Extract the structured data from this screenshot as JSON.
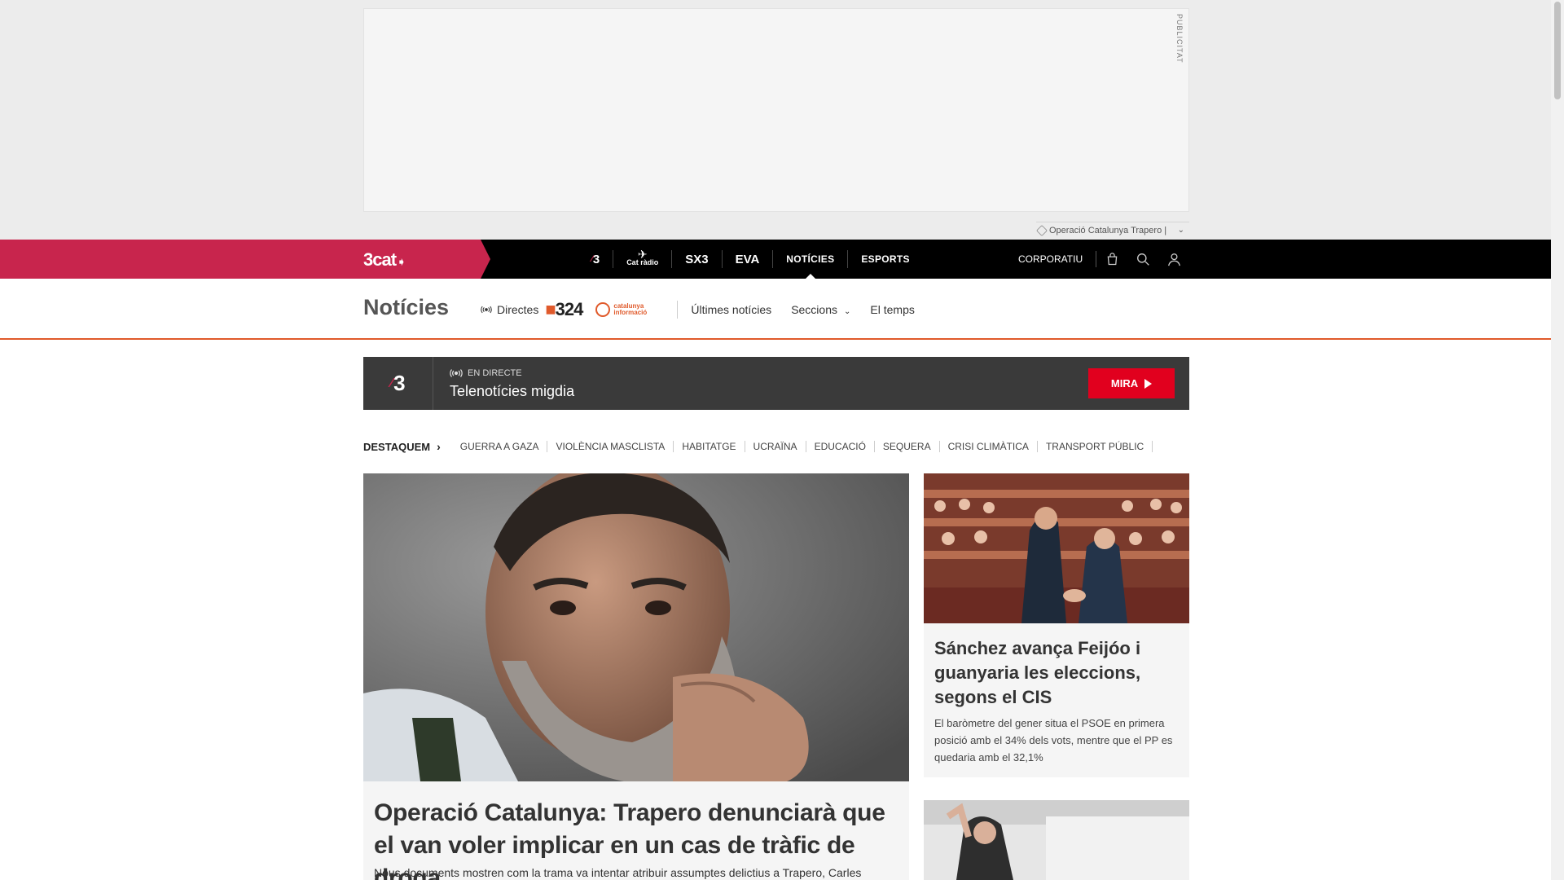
{
  "ad": {
    "label": "PUBLICITAT",
    "sponsor_text": "Operació Catalunya Trapero |"
  },
  "topnav": {
    "brand": "3cat",
    "channels": [
      {
        "label": "3"
      },
      {
        "label": "Cat ràdio"
      },
      {
        "label": "SX3"
      },
      {
        "label": "EVA"
      },
      {
        "label": "NOTÍCIES"
      },
      {
        "label": "ESPORTS"
      }
    ],
    "corporate": "CORPORATIU"
  },
  "section": {
    "title": "Notícies",
    "directes": "Directes",
    "logo_324": "324",
    "logo_ci": "catalunya informació",
    "links": [
      "Últimes notícies",
      "Seccions",
      "El temps"
    ]
  },
  "live": {
    "channel": "3",
    "tag": "EN DIRECTE",
    "title": "Telenotícies migdia",
    "button": "MIRA"
  },
  "highlights": {
    "head": "DESTAQUEM",
    "items": [
      "GUERRA A GAZA",
      "VIOLÈNCIA MASCLISTA",
      "HABITATGE",
      "UCRAÏNA",
      "EDUCACIÓ",
      "SEQUERA",
      "CRISI CLIMÀTICA",
      "TRANSPORT PÚBLIC"
    ]
  },
  "main_article": {
    "title": "Operació Catalunya: Trapero denunciarà que el van voler implicar en un cas de tràfic de droga",
    "lead": "Nous documents mostren com la trama va intentar atribuir assumptes delictius a Trapero, Carles"
  },
  "side_article": {
    "title": "Sánchez avança Feijóo i guanyaria les eleccions, segons el CIS",
    "lead": "El baròmetre del gener situa el PSOE en primera posició amb el 34% dels vots, mentre que el PP es quedaria amb el 32,1%"
  },
  "colors": {
    "brand": "#c8254d",
    "accent": "#e05a2b",
    "live_button": "#e1001e"
  }
}
